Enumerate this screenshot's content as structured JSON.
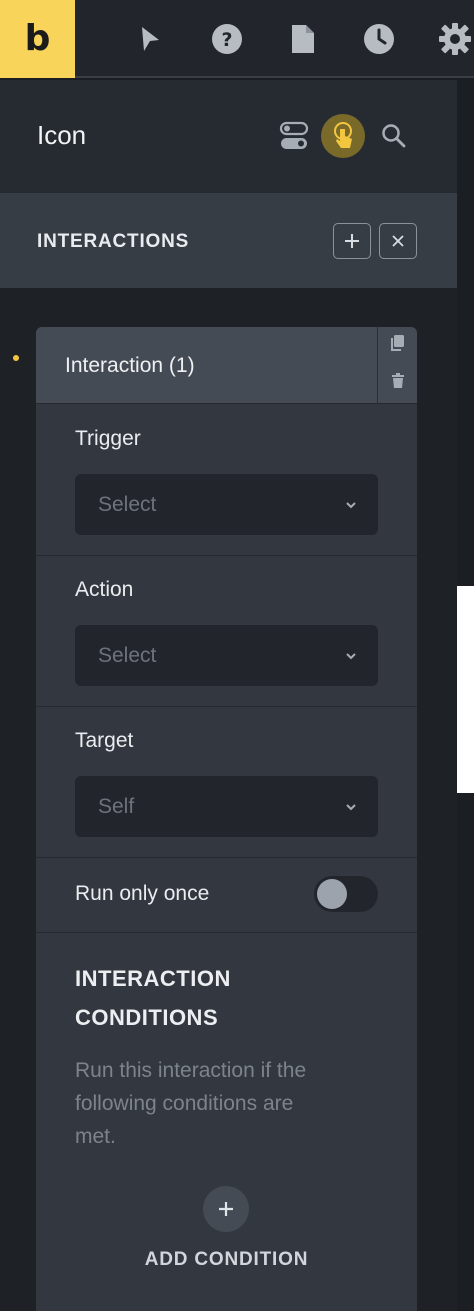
{
  "toolbar": {
    "logo": "b",
    "icons": [
      "cursor-icon",
      "help-icon",
      "page-icon",
      "history-icon",
      "settings-icon"
    ]
  },
  "element": {
    "title": "Icon",
    "header_icons": [
      "toggle-icon",
      "interactions-hand-icon",
      "search-icon"
    ]
  },
  "interactions": {
    "section_title": "INTERACTIONS",
    "add_label": "+",
    "close_label": "×",
    "item_title": "Interaction (1)",
    "trigger": {
      "label": "Trigger",
      "value": "Select"
    },
    "action": {
      "label": "Action",
      "value": "Select"
    },
    "target": {
      "label": "Target",
      "value": "Self"
    },
    "run_once": {
      "label": "Run only once",
      "enabled": false
    },
    "conditions": {
      "title_line1": "INTERACTION",
      "title_line2": "CONDITIONS",
      "desc_line1": "Run this interaction if the",
      "desc_line2": "following conditions are",
      "desc_line3": "met.",
      "add_label": "ADD CONDITION"
    }
  },
  "colors": {
    "accent": "#f8d45a",
    "panel": "#262a31",
    "section": "#373d45",
    "card": "#333840"
  }
}
